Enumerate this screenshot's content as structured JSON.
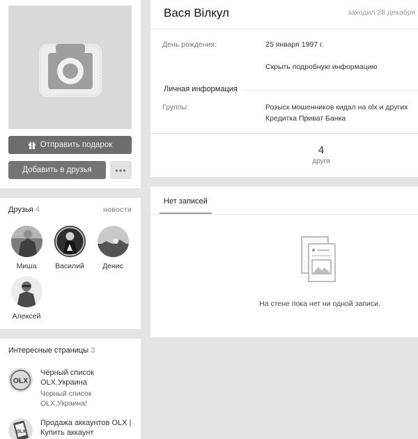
{
  "actions": {
    "gift_label": "Отправить подарок",
    "add_friend_label": "Добавить в друзья",
    "more_label": "•••"
  },
  "friends": {
    "title": "Друзья",
    "count": "4",
    "news_link": "новости",
    "items": [
      {
        "name": "Миша"
      },
      {
        "name": "Василий"
      },
      {
        "name": "Денис"
      },
      {
        "name": "Алексей"
      }
    ]
  },
  "pages": {
    "title": "Интересные страницы",
    "count": "3",
    "items": [
      {
        "logo": "OLX",
        "name": "Чёрный список OLX.Украина",
        "desc": "Черный список OLX,Украина!"
      },
      {
        "logo": "OLX",
        "name": "Продажа аккаунтов OLX | Купить аккаунт",
        "desc": ""
      }
    ]
  },
  "profile": {
    "name": "Вася Вілкул",
    "last_seen": "заходил 28 декабря",
    "birthday_label": "День рождения:",
    "birthday_value": "25 января 1997 г.",
    "hide_info": "Скрыть подробную информацию",
    "personal_header": "Личная информация",
    "groups_label": "Группы:",
    "groups_line1": "Розыск мошенников кидал на olx и других",
    "groups_line2": "Кредитка Приват Банка",
    "friends_count": "4",
    "friends_count_label": "друга"
  },
  "wall": {
    "tab_label": "Нет записей",
    "empty_text": "На стене пока нет ни одной записи."
  }
}
